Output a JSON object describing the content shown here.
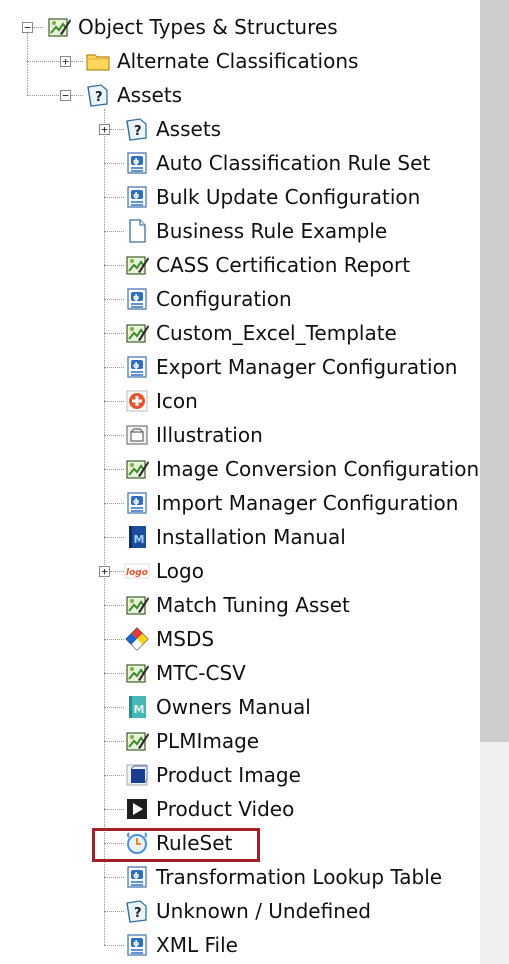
{
  "tree": {
    "root": {
      "label": "Object Types & Structures",
      "icon": "object-type-icon",
      "expanded": true
    },
    "level1": [
      {
        "label": "Alternate Classifications",
        "icon": "folder-icon",
        "expanded": false
      },
      {
        "label": "Assets",
        "icon": "unknown-asset-icon",
        "expanded": true
      }
    ],
    "assets_children": [
      {
        "label": "Assets",
        "icon": "unknown-asset-icon",
        "has_children": true
      },
      {
        "label": "Auto Classification Rule Set",
        "icon": "config-file-icon"
      },
      {
        "label": "Bulk Update Configuration",
        "icon": "config-file-icon"
      },
      {
        "label": "Business Rule Example",
        "icon": "blank-document-icon"
      },
      {
        "label": "CASS Certification Report",
        "icon": "object-type-icon"
      },
      {
        "label": "Configuration",
        "icon": "config-file-icon"
      },
      {
        "label": "Custom_Excel_Template",
        "icon": "object-type-icon"
      },
      {
        "label": "Export Manager Configuration",
        "icon": "config-file-icon"
      },
      {
        "label": "Icon",
        "icon": "icon-asset-icon"
      },
      {
        "label": "Illustration",
        "icon": "illustration-icon"
      },
      {
        "label": "Image Conversion Configuration",
        "icon": "object-type-icon"
      },
      {
        "label": "Import Manager Configuration",
        "icon": "config-file-icon"
      },
      {
        "label": "Installation Manual",
        "icon": "manual-book-icon"
      },
      {
        "label": "Logo",
        "icon": "logo-icon",
        "has_children": true
      },
      {
        "label": "Match Tuning Asset",
        "icon": "object-type-icon"
      },
      {
        "label": "MSDS",
        "icon": "msds-diamond-icon"
      },
      {
        "label": "MTC-CSV",
        "icon": "object-type-icon"
      },
      {
        "label": "Owners Manual",
        "icon": "owners-manual-icon"
      },
      {
        "label": "PLMImage",
        "icon": "object-type-icon"
      },
      {
        "label": "Product Image",
        "icon": "product-image-icon"
      },
      {
        "label": "Product Video",
        "icon": "product-video-icon"
      },
      {
        "label": "RuleSet",
        "icon": "ruleset-clock-icon",
        "highlighted": true
      },
      {
        "label": "Transformation Lookup Table",
        "icon": "config-file-icon"
      },
      {
        "label": "Unknown / Undefined",
        "icon": "unknown-asset-icon"
      },
      {
        "label": "XML File",
        "icon": "config-file-icon"
      }
    ]
  },
  "colors": {
    "highlight_border": "#a3202a",
    "scrollbar_track": "#f0f0f0",
    "scrollbar_thumb": "#cdcdcd"
  }
}
